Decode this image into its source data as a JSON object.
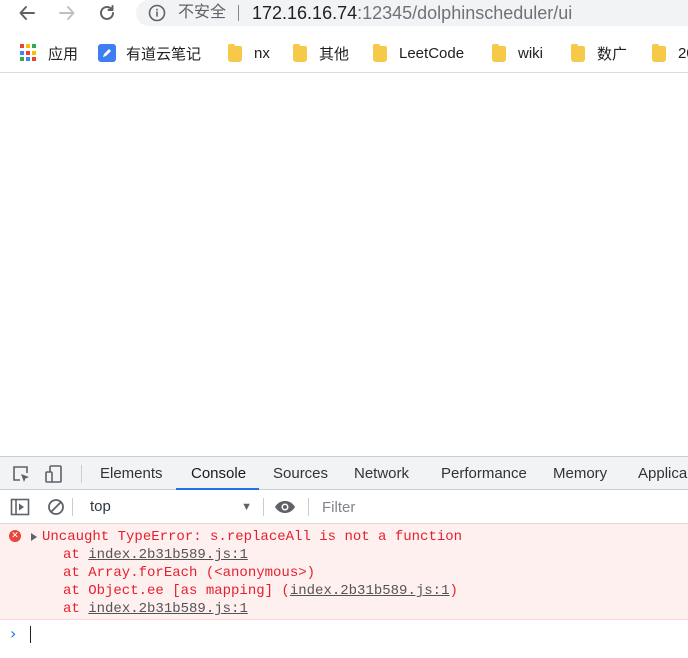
{
  "browser": {
    "security_label": "不安全",
    "url_host": "172.16.16.74",
    "url_rest": ":12345/dolphinscheduler/ui"
  },
  "bookmarks": [
    {
      "label": "应用",
      "icon": "apps-grid-icon"
    },
    {
      "label": "有道云笔记",
      "icon": "youdao-note-icon"
    },
    {
      "label": "nx",
      "icon": "folder-icon"
    },
    {
      "label": "其他",
      "icon": "folder-icon"
    },
    {
      "label": "LeetCode",
      "icon": "folder-icon"
    },
    {
      "label": "wiki",
      "icon": "folder-icon"
    },
    {
      "label": "数广",
      "icon": "folder-icon"
    },
    {
      "label": "20",
      "icon": "folder-icon"
    }
  ],
  "devtools": {
    "tabs": [
      "Elements",
      "Console",
      "Sources",
      "Network",
      "Performance",
      "Memory",
      "Applica"
    ],
    "active_tab": "Console",
    "context": "top",
    "filter_placeholder": "Filter",
    "error": {
      "message": "Uncaught TypeError: s.replaceAll is not a function",
      "stack": [
        {
          "prefix": "at ",
          "link": "index.2b31b589.js:1",
          "suffix": ""
        },
        {
          "prefix": "at Array.forEach (<anonymous>)",
          "link": "",
          "suffix": ""
        },
        {
          "prefix": "at Object.ee [as mapping] (",
          "link": "index.2b31b589.js:1",
          "suffix": ")"
        },
        {
          "prefix": "at ",
          "link": "index.2b31b589.js:1",
          "suffix": ""
        }
      ]
    },
    "prompt_symbol": "›"
  },
  "colors": {
    "accent": "#1a73e8",
    "error_text": "#e5202e",
    "error_bg": "#fff0f0",
    "folder": "#f7c948"
  }
}
